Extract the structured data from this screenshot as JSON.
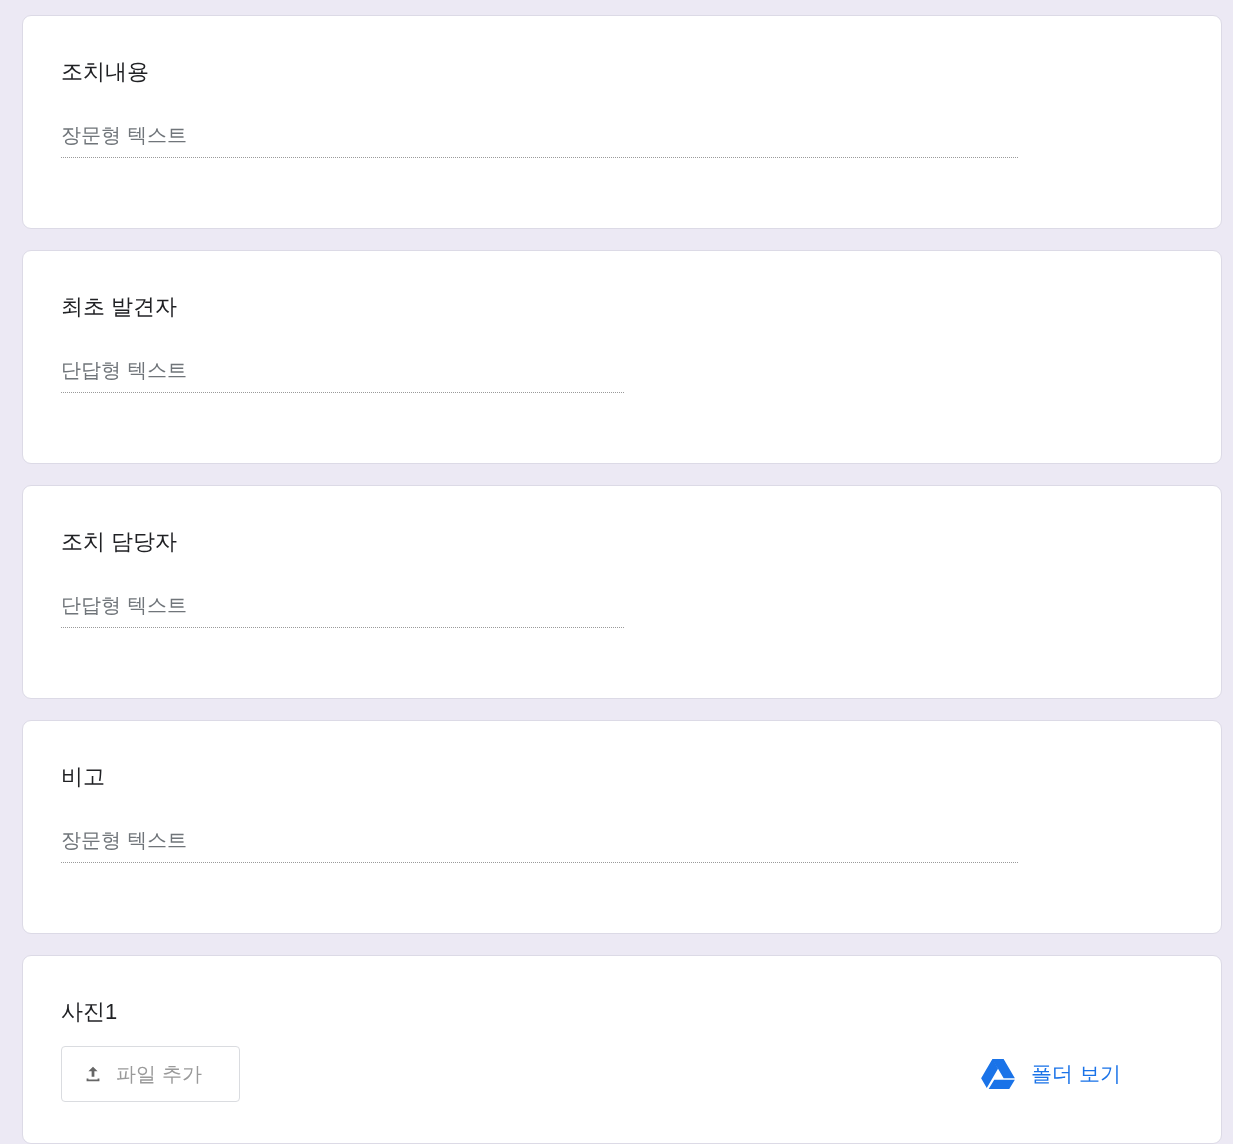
{
  "questions": [
    {
      "kind": "long",
      "title": "조치내용",
      "placeholder": "장문형 텍스트"
    },
    {
      "kind": "short",
      "title": "최초 발견자",
      "placeholder": "단답형 텍스트"
    },
    {
      "kind": "short",
      "title": "조치 담당자",
      "placeholder": "단답형 텍스트"
    },
    {
      "kind": "long",
      "title": "비고",
      "placeholder": "장문형 텍스트"
    },
    {
      "kind": "file",
      "title": "사진1",
      "button": "파일 추가",
      "link": "폴더 보기"
    }
  ]
}
